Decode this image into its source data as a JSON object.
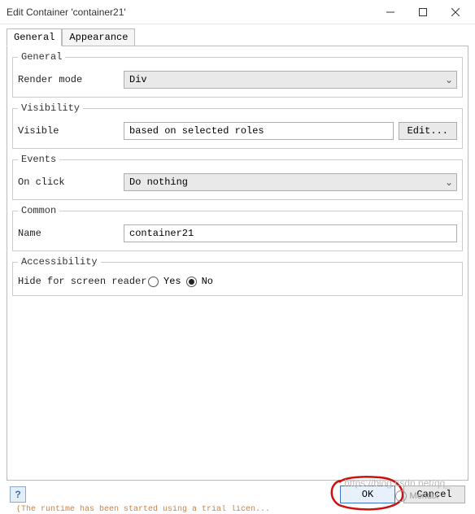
{
  "titlebar": {
    "title": "Edit Container 'container21'"
  },
  "tabs": {
    "general": "General",
    "appearance": "Appearance"
  },
  "groups": {
    "general": {
      "legend": "General",
      "render_mode_label": "Render mode",
      "render_mode_value": "Div"
    },
    "visibility": {
      "legend": "Visibility",
      "visible_label": "Visible",
      "visible_value": "based on selected roles",
      "edit_button": "Edit..."
    },
    "events": {
      "legend": "Events",
      "on_click_label": "On click",
      "on_click_value": "Do nothing"
    },
    "common": {
      "legend": "Common",
      "name_label": "Name",
      "name_value": "container21"
    },
    "accessibility": {
      "legend": "Accessibility",
      "hide_label": "Hide for screen reader",
      "yes": "Yes",
      "no": "No",
      "selected": "no"
    }
  },
  "footer": {
    "ok": "OK",
    "cancel": "Cancel"
  },
  "watermark": {
    "url": "https://blog.csdn.net/qq_...",
    "name": "Mendix"
  },
  "cutoff": "(The runtime has been started using a trial licen..."
}
